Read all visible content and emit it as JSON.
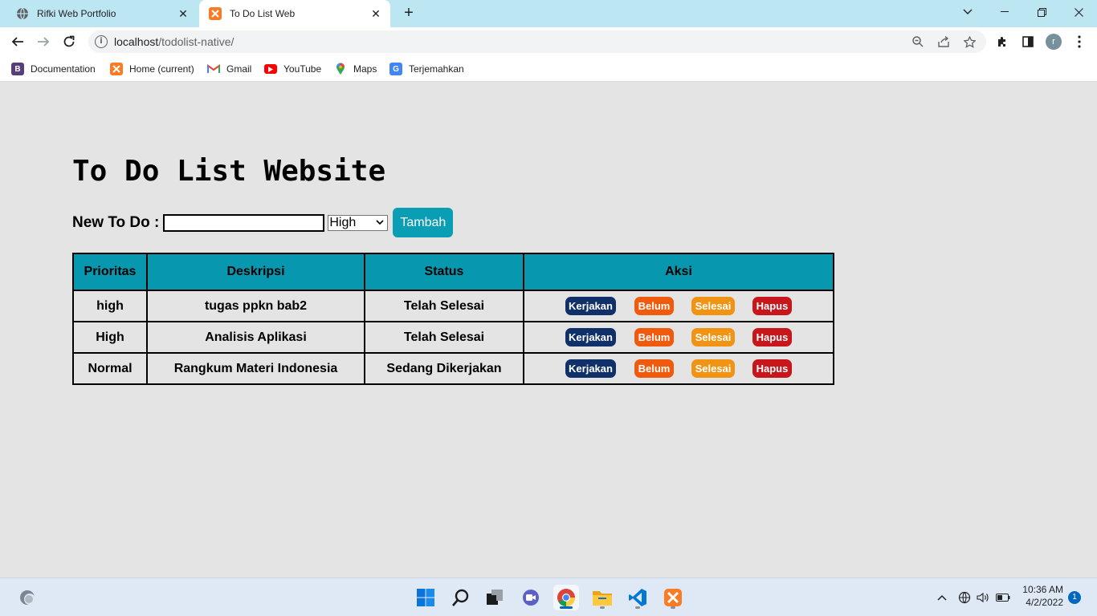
{
  "browser": {
    "tabs": [
      {
        "title": "Rifki Web Portfolio",
        "active": false,
        "favicon": "globe-icon"
      },
      {
        "title": "To Do List Web",
        "active": true,
        "favicon": "xampp-icon"
      }
    ],
    "url_host": "localhost",
    "url_path": "/todolist-native/",
    "profile_initial": "r",
    "bookmarks": [
      {
        "label": "Documentation",
        "icon": "bootstrap-icon",
        "color": "#563d7c"
      },
      {
        "label": "Home (current)",
        "icon": "xampp-icon",
        "color": "#fb7a24"
      },
      {
        "label": "Gmail",
        "icon": "gmail-icon",
        "color": "#ea4335"
      },
      {
        "label": "YouTube",
        "icon": "youtube-icon",
        "color": "#ff0000"
      },
      {
        "label": "Maps",
        "icon": "maps-icon",
        "color": "#34a853"
      },
      {
        "label": "Terjemahkan",
        "icon": "translate-icon",
        "color": "#4285f4"
      }
    ]
  },
  "page": {
    "title": "To Do List Website",
    "form": {
      "label": "New To Do :",
      "input_value": "",
      "priority_selected": "High",
      "add_button": "Tambah"
    },
    "table": {
      "headers": [
        "Prioritas",
        "Deskripsi",
        "Status",
        "Aksi"
      ],
      "action_labels": {
        "kerjakan": "Kerjakan",
        "belum": "Belum",
        "selesai": "Selesai",
        "hapus": "Hapus"
      },
      "rows": [
        {
          "prioritas": "high",
          "deskripsi": "tugas ppkn bab2",
          "status": "Telah Selesai"
        },
        {
          "prioritas": "High",
          "deskripsi": "Analisis Aplikasi",
          "status": "Telah Selesai"
        },
        {
          "prioritas": "Normal",
          "deskripsi": "Rangkum Materi Indonesia",
          "status": "Sedang Dikerjakan"
        }
      ]
    },
    "colors": {
      "header_bg": "#0797ae",
      "kerjakan": "#10306a",
      "belum": "#f05a0c",
      "selesai": "#f29413",
      "hapus": "#c8161d"
    }
  },
  "taskbar": {
    "time": "10:36 AM",
    "date": "4/2/2022",
    "notifications": "1"
  }
}
